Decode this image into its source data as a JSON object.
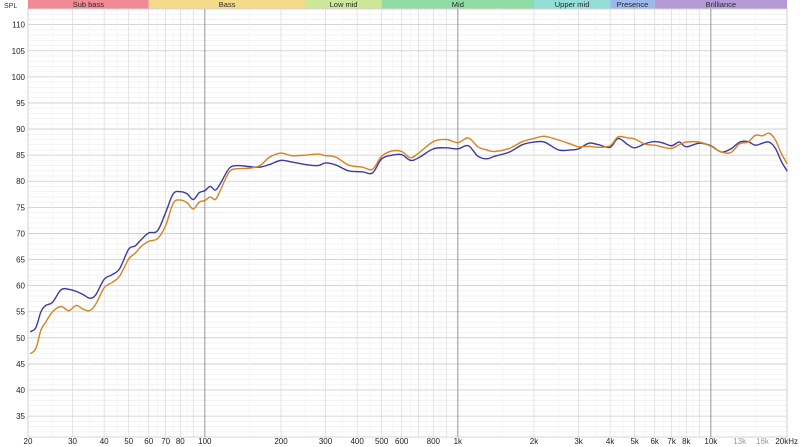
{
  "chart_data": {
    "type": "line",
    "ylabel": "SPL",
    "xscale": "log",
    "xlim": [
      20,
      20000
    ],
    "ylim": [
      31,
      113
    ],
    "grid": true,
    "bands": [
      {
        "name": "Sub bass",
        "from": 20,
        "to": 60,
        "color": "#f08a94"
      },
      {
        "name": "Bass",
        "from": 60,
        "to": 250,
        "color": "#f3d98a"
      },
      {
        "name": "Low mid",
        "from": 250,
        "to": 500,
        "color": "#cde79a"
      },
      {
        "name": "Mid",
        "from": 500,
        "to": 2000,
        "color": "#8fdca5"
      },
      {
        "name": "Upper mid",
        "from": 2000,
        "to": 4000,
        "color": "#94dcd6"
      },
      {
        "name": "Presence",
        "from": 4000,
        "to": 6000,
        "color": "#9cb7ea"
      },
      {
        "name": "Brilliance",
        "from": 6000,
        "to": 20000,
        "color": "#b39ad6"
      }
    ],
    "y_ticks": [
      35,
      40,
      45,
      50,
      55,
      60,
      65,
      70,
      75,
      80,
      85,
      90,
      95,
      100,
      105,
      110
    ],
    "x_ticks": [
      {
        "value": 20,
        "label": "20"
      },
      {
        "value": 30,
        "label": "30"
      },
      {
        "value": 40,
        "label": "40"
      },
      {
        "value": 50,
        "label": "50"
      },
      {
        "value": 60,
        "label": "60"
      },
      {
        "value": 70,
        "label": "70"
      },
      {
        "value": 80,
        "label": "80"
      },
      {
        "value": 100,
        "label": "100"
      },
      {
        "value": 200,
        "label": "200"
      },
      {
        "value": 300,
        "label": "300"
      },
      {
        "value": 400,
        "label": "400"
      },
      {
        "value": 500,
        "label": "500"
      },
      {
        "value": 600,
        "label": "600"
      },
      {
        "value": 800,
        "label": "800"
      },
      {
        "value": 1000,
        "label": "1k"
      },
      {
        "value": 2000,
        "label": "2k"
      },
      {
        "value": 3000,
        "label": "3k"
      },
      {
        "value": 4000,
        "label": "4k"
      },
      {
        "value": 5000,
        "label": "5k"
      },
      {
        "value": 6000,
        "label": "6k"
      },
      {
        "value": 7000,
        "label": "7k"
      },
      {
        "value": 8000,
        "label": "8k"
      },
      {
        "value": 10000,
        "label": "10k"
      },
      {
        "value": 13000,
        "label": "13k",
        "muted": true
      },
      {
        "value": 16000,
        "label": "16k",
        "muted": true
      },
      {
        "value": 20000,
        "label": "20kHz"
      }
    ],
    "series": [
      {
        "color": "#3a3aa8",
        "points": [
          [
            20.5,
            51.2
          ],
          [
            21.5,
            52
          ],
          [
            22.5,
            55
          ],
          [
            23.5,
            56.2
          ],
          [
            25,
            56.8
          ],
          [
            27,
            59.2
          ],
          [
            29,
            59.3
          ],
          [
            31,
            58.9
          ],
          [
            33,
            58.3
          ],
          [
            35,
            57.6
          ],
          [
            37,
            58.2
          ],
          [
            40,
            61.2
          ],
          [
            43,
            62.1
          ],
          [
            46,
            63.2
          ],
          [
            50,
            67
          ],
          [
            53,
            67.6
          ],
          [
            56,
            68.8
          ],
          [
            60,
            70.1
          ],
          [
            65,
            70.5
          ],
          [
            70,
            74
          ],
          [
            75,
            77.6
          ],
          [
            80,
            78
          ],
          [
            85,
            77.6
          ],
          [
            90,
            76.5
          ],
          [
            95,
            77.8
          ],
          [
            100,
            78.2
          ],
          [
            105,
            79
          ],
          [
            110,
            78.3
          ],
          [
            115,
            79.5
          ],
          [
            125,
            82.5
          ],
          [
            135,
            83
          ],
          [
            150,
            82.8
          ],
          [
            165,
            82.7
          ],
          [
            180,
            83.2
          ],
          [
            200,
            84
          ],
          [
            220,
            83.7
          ],
          [
            250,
            83.2
          ],
          [
            280,
            83
          ],
          [
            300,
            83.5
          ],
          [
            330,
            83.1
          ],
          [
            370,
            82
          ],
          [
            420,
            81.8
          ],
          [
            460,
            81.6
          ],
          [
            500,
            84.3
          ],
          [
            550,
            85
          ],
          [
            600,
            85.1
          ],
          [
            650,
            84
          ],
          [
            700,
            84.5
          ],
          [
            800,
            86.2
          ],
          [
            900,
            86.4
          ],
          [
            1000,
            86.2
          ],
          [
            1100,
            86.8
          ],
          [
            1200,
            84.8
          ],
          [
            1300,
            84.3
          ],
          [
            1400,
            84.8
          ],
          [
            1600,
            85.6
          ],
          [
            1800,
            87
          ],
          [
            2000,
            87.5
          ],
          [
            2200,
            87.5
          ],
          [
            2500,
            86
          ],
          [
            2800,
            86
          ],
          [
            3000,
            86.2
          ],
          [
            3300,
            87.3
          ],
          [
            3600,
            87
          ],
          [
            4000,
            86.5
          ],
          [
            4300,
            88.2
          ],
          [
            4700,
            87
          ],
          [
            5000,
            86.4
          ],
          [
            5500,
            87.2
          ],
          [
            6000,
            87.6
          ],
          [
            6500,
            87.3
          ],
          [
            7000,
            86.8
          ],
          [
            7500,
            87.5
          ],
          [
            8000,
            86.6
          ],
          [
            9000,
            87.3
          ],
          [
            10000,
            86.8
          ],
          [
            11000,
            85.6
          ],
          [
            12000,
            86.2
          ],
          [
            13000,
            87.5
          ],
          [
            14000,
            87.6
          ],
          [
            15000,
            86.9
          ],
          [
            16000,
            87.3
          ],
          [
            17000,
            87.5
          ],
          [
            18000,
            86.3
          ],
          [
            19000,
            83.8
          ],
          [
            20000,
            82
          ]
        ]
      },
      {
        "color": "#d9821e",
        "points": [
          [
            20.5,
            47
          ],
          [
            21.5,
            48
          ],
          [
            22.5,
            51.5
          ],
          [
            23.5,
            53
          ],
          [
            25,
            55
          ],
          [
            27,
            56
          ],
          [
            29,
            55.2
          ],
          [
            31,
            56.2
          ],
          [
            33,
            55.5
          ],
          [
            35,
            55.2
          ],
          [
            37,
            56.4
          ],
          [
            40,
            59.6
          ],
          [
            43,
            60.6
          ],
          [
            46,
            61.8
          ],
          [
            50,
            65.1
          ],
          [
            53,
            66.2
          ],
          [
            56,
            67.5
          ],
          [
            60,
            68.5
          ],
          [
            65,
            69
          ],
          [
            70,
            71.5
          ],
          [
            75,
            75.8
          ],
          [
            80,
            76.4
          ],
          [
            85,
            75.9
          ],
          [
            90,
            74.7
          ],
          [
            95,
            76
          ],
          [
            100,
            76.3
          ],
          [
            105,
            77
          ],
          [
            110,
            76.5
          ],
          [
            115,
            78.2
          ],
          [
            125,
            81.8
          ],
          [
            135,
            82.4
          ],
          [
            150,
            82.5
          ],
          [
            165,
            83
          ],
          [
            180,
            84.6
          ],
          [
            200,
            85.4
          ],
          [
            220,
            84.9
          ],
          [
            250,
            85
          ],
          [
            280,
            85.2
          ],
          [
            300,
            84.9
          ],
          [
            330,
            84.6
          ],
          [
            370,
            83.1
          ],
          [
            420,
            82.7
          ],
          [
            460,
            82.3
          ],
          [
            500,
            84.8
          ],
          [
            550,
            85.8
          ],
          [
            600,
            85.7
          ],
          [
            650,
            84.5
          ],
          [
            700,
            85.4
          ],
          [
            800,
            87.6
          ],
          [
            900,
            88
          ],
          [
            1000,
            87.4
          ],
          [
            1100,
            88.3
          ],
          [
            1200,
            86.6
          ],
          [
            1300,
            86
          ],
          [
            1400,
            85.7
          ],
          [
            1600,
            86.3
          ],
          [
            1800,
            87.6
          ],
          [
            2000,
            88.2
          ],
          [
            2200,
            88.6
          ],
          [
            2500,
            87.9
          ],
          [
            2800,
            87.1
          ],
          [
            3000,
            86.6
          ],
          [
            3300,
            86.7
          ],
          [
            3600,
            86.5
          ],
          [
            4000,
            86.8
          ],
          [
            4300,
            88.5
          ],
          [
            4700,
            88.3
          ],
          [
            5000,
            88.1
          ],
          [
            5500,
            87.1
          ],
          [
            6000,
            86.9
          ],
          [
            6500,
            86.5
          ],
          [
            7000,
            86.3
          ],
          [
            7500,
            87
          ],
          [
            8000,
            87.5
          ],
          [
            9000,
            87.5
          ],
          [
            10000,
            86.7
          ],
          [
            11000,
            85.6
          ],
          [
            12000,
            85.5
          ],
          [
            13000,
            87.2
          ],
          [
            14000,
            87.5
          ],
          [
            15000,
            88.8
          ],
          [
            16000,
            88.7
          ],
          [
            17000,
            89.2
          ],
          [
            18000,
            87.9
          ],
          [
            19000,
            85.3
          ],
          [
            20000,
            83.4
          ]
        ]
      }
    ]
  }
}
